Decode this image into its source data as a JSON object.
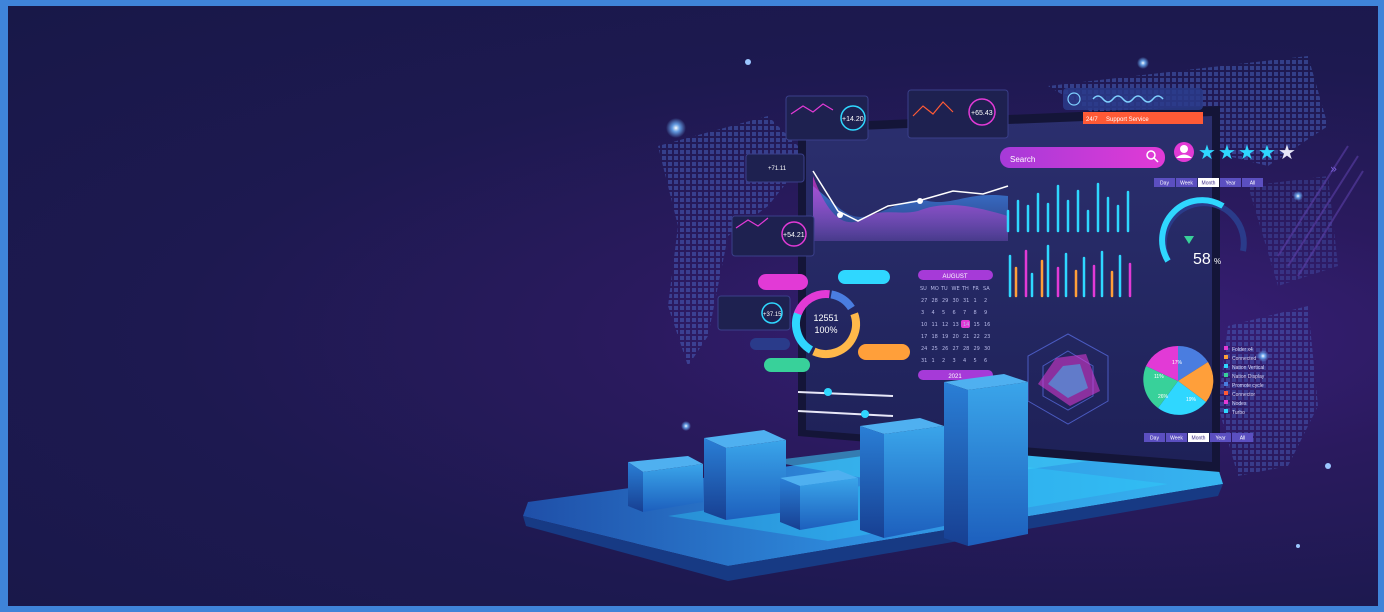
{
  "search": {
    "placeholder": "Search"
  },
  "support": {
    "label": "Support Service",
    "hours": "24/7"
  },
  "rating": {
    "filled": 4,
    "total": 5
  },
  "cards": {
    "card1_value": "+14.20",
    "card2_value": "+65.43",
    "card3_value": "+54.21",
    "card4_value": "+37.15",
    "card5_value": "+71.11"
  },
  "donut": {
    "center_value": "12551",
    "center_percent": "100%"
  },
  "calendar": {
    "month": "AUGUST",
    "year": "2021",
    "weekdays": [
      "SU",
      "MO",
      "TU",
      "WE",
      "TH",
      "FR",
      "SA"
    ],
    "days": [
      "27",
      "28",
      "29",
      "30",
      "31",
      "1",
      "2",
      "3",
      "4",
      "5",
      "6",
      "7",
      "8",
      "9",
      "10",
      "11",
      "12",
      "13",
      "14",
      "15",
      "16",
      "17",
      "18",
      "19",
      "20",
      "21",
      "22",
      "23",
      "24",
      "25",
      "26",
      "27",
      "28",
      "29",
      "30",
      "31",
      "1",
      "2",
      "3",
      "4",
      "5",
      "6"
    ],
    "highlight": "14"
  },
  "gauge": {
    "value": "58",
    "unit": "%"
  },
  "tabs_top": [
    "Day",
    "Week",
    "Month",
    "Year",
    "All"
  ],
  "tabs_bottom": [
    "Day",
    "Week",
    "Month",
    "Year",
    "All"
  ],
  "legend_items": [
    "Folder x4",
    "Connected",
    "Nation Vertical",
    "Nation Display",
    "Promote cycle",
    "Connector",
    "Nodes",
    "Turbo"
  ],
  "pie_labels": [
    "17%",
    "26%",
    "19%",
    "11%"
  ],
  "colors": {
    "accent_pink": "#e23ad6",
    "accent_cyan": "#2fd7ff",
    "accent_orange": "#ff9f3a",
    "bar_blue": "#2f8fe0",
    "support_red": "#ff5a36"
  }
}
